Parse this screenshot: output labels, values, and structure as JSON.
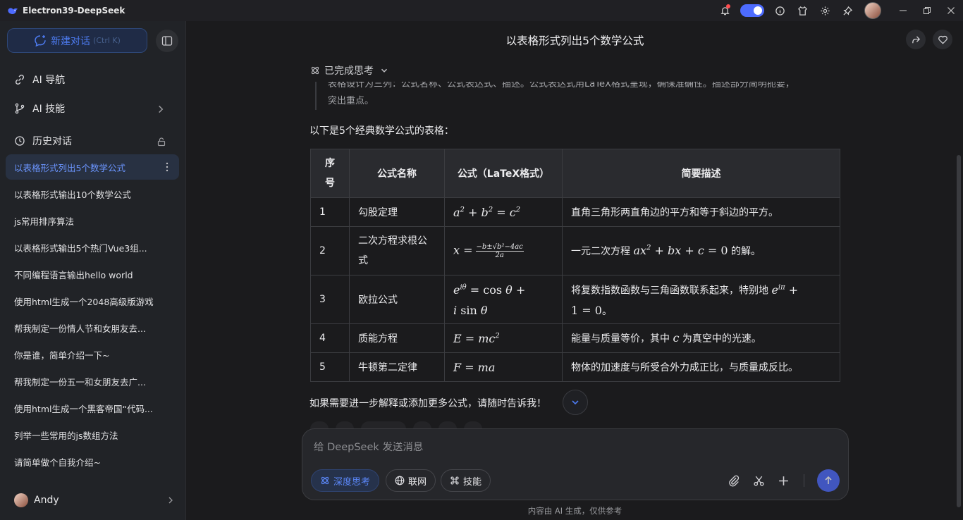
{
  "window": {
    "title": "Electron39-DeepSeek",
    "toggle_on": true
  },
  "sidebar": {
    "new_chat_label": "新建对话",
    "new_chat_shortcut": "(Ctrl K)",
    "nav": [
      {
        "label": "AI 导航",
        "icon": "compass-icon"
      },
      {
        "label": "AI 技能",
        "icon": "branch-icon"
      }
    ],
    "history_label": "历史对话",
    "history": [
      {
        "label": "以表格形式列出5个数学公式",
        "active": true
      },
      {
        "label": "以表格形式输出10个数学公式"
      },
      {
        "label": "js常用排序算法"
      },
      {
        "label": "以表格形式输出5个热门Vue3组..."
      },
      {
        "label": "不同编程语言输出hello world"
      },
      {
        "label": "使用html生成一个2048高级版游戏"
      },
      {
        "label": "帮我制定一份情人节和女朋友去..."
      },
      {
        "label": "你是谁，简单介绍一下~"
      },
      {
        "label": "帮我制定一份五一和女朋友去广..."
      },
      {
        "label": "使用html生成一个黑客帝国“代码..."
      },
      {
        "label": "列举一些常用的js数组方法"
      },
      {
        "label": "请简单做个自我介绍~"
      }
    ],
    "user_name": "Andy"
  },
  "chat": {
    "title": "以表格形式列出5个数学公式",
    "think_label": "已完成思考",
    "think_line1": "表格设计为三列：公式名称、公式表达式、描述。公式表达式用LaTeX格式呈现，确保准确性。描述部分简明扼要，",
    "think_line2": "突出重点。",
    "intro": "以下是5个经典数学公式的表格：",
    "table": {
      "headers": [
        "序号",
        "公式名称",
        "公式（LaTeX格式）",
        "简要描述"
      ],
      "rows": [
        {
          "no": "1",
          "name": "勾股定理",
          "desc": "直角三角形两直角边的平方和等于斜边的平方。"
        },
        {
          "no": "2",
          "name": "二次方程求根公式",
          "desc_pre": "一元二次方程 ",
          "desc_post": " 的解。"
        },
        {
          "no": "3",
          "name": "欧拉公式",
          "desc_pre": "将复数指数函数与三角函数联系起来，特别地 ",
          "desc_post": "。"
        },
        {
          "no": "4",
          "name": "质能方程",
          "desc_pre": "能量与质量等价，其中 ",
          "desc_post": " 为真空中的光速。"
        },
        {
          "no": "5",
          "name": "牛顿第二定律",
          "desc": "物体的加速度与所受合外力成正比，与质量成反比。"
        }
      ]
    },
    "closing": "如果需要进一步解释或添加更多公式，请随时告诉我！"
  },
  "composer": {
    "placeholder": "给 DeepSeek 发送消息",
    "deep_think": "深度思考",
    "web_search": "联网",
    "skills": "技能"
  },
  "disclaimer": "内容由 AI 生成，仅供参考",
  "colors": {
    "accent": "#4d6bfe",
    "background": "#1b1b1d",
    "sidebar": "#212327"
  }
}
